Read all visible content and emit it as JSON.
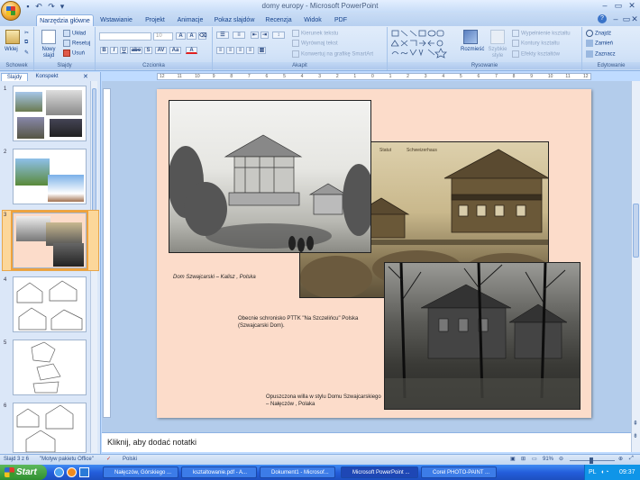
{
  "window": {
    "title": "domy europy - Microsoft PowerPoint"
  },
  "ribbon_tabs": [
    "Narzędzia główne",
    "Wstawianie",
    "Projekt",
    "Animacje",
    "Pokaz slajdów",
    "Recenzja",
    "Widok",
    "PDF"
  ],
  "groups": {
    "clipboard": {
      "label": "Schowek",
      "paste": "Wklej"
    },
    "slides": {
      "label": "Slajdy",
      "new_slide": "Nowy slajd",
      "layout": "Układ",
      "reset": "Resetuj",
      "delete": "Usuń"
    },
    "font": {
      "label": "Czcionka",
      "font_size": "10",
      "bold": "B",
      "italic": "I",
      "underline": "U",
      "strike": "abe",
      "shadow": "S",
      "spacing": "AV",
      "case": "Aa",
      "color": "A"
    },
    "paragraph": {
      "label": "Akapit",
      "text_direction": "Kierunek tekstu",
      "align_text": "Wyrównaj tekst",
      "smartart": "Konwertuj na grafikę SmartArt"
    },
    "drawing": {
      "label": "Rysowanie",
      "arrange": "Rozmieść",
      "quick_styles": "Szybkie style",
      "fill": "Wypełnienie kształtu",
      "outline": "Kontury kształtu",
      "effects": "Efekty kształtów"
    },
    "editing": {
      "label": "Edytowanie",
      "find": "Znajdź",
      "replace": "Zamień",
      "select": "Zaznacz"
    }
  },
  "pane_tabs": [
    "Slajdy",
    "Konspekt"
  ],
  "thumbnails": [
    "1",
    "2",
    "3",
    "4",
    "5",
    "6"
  ],
  "ruler_ticks": [
    "12",
    "11",
    "10",
    "9",
    "8",
    "7",
    "6",
    "5",
    "4",
    "3",
    "2",
    "1",
    "0",
    "1",
    "2",
    "3",
    "4",
    "5",
    "6",
    "7",
    "8",
    "9",
    "10",
    "11",
    "12"
  ],
  "slide": {
    "photo_label_1": "Statut",
    "photo_label_2": "Schweizerhaus",
    "caption_1": "Dom Szwajcarski – Kalisz , Polska",
    "caption_2_line1": "Obecnie schronisko  PTTK \"Na Szczelińcu\" Polska",
    "caption_2_line2": "(Szwajcarski Dom).",
    "caption_3_line1": "Opuszczona willa w stylu Domu  Szwajcarskiego",
    "caption_3_line2": "– Nałęczów , Polaka"
  },
  "notes_placeholder": "Kliknij, aby dodać notatki",
  "status": {
    "slide_info": "Slajd 3 z 6",
    "theme": "\"Motyw pakietu Office\"",
    "language": "Polski",
    "zoom": "91%"
  },
  "taskbar": {
    "start": "Start",
    "tasks": [
      "Nałęczów, Górskiego ...",
      "ksztaltowanie.pdf - A...",
      "Dokument1 - Microsof...",
      "Microsoft PowerPoint ...",
      "Corel PHOTO-PAINT ..."
    ],
    "lang": "PL",
    "clock": "09:37"
  }
}
